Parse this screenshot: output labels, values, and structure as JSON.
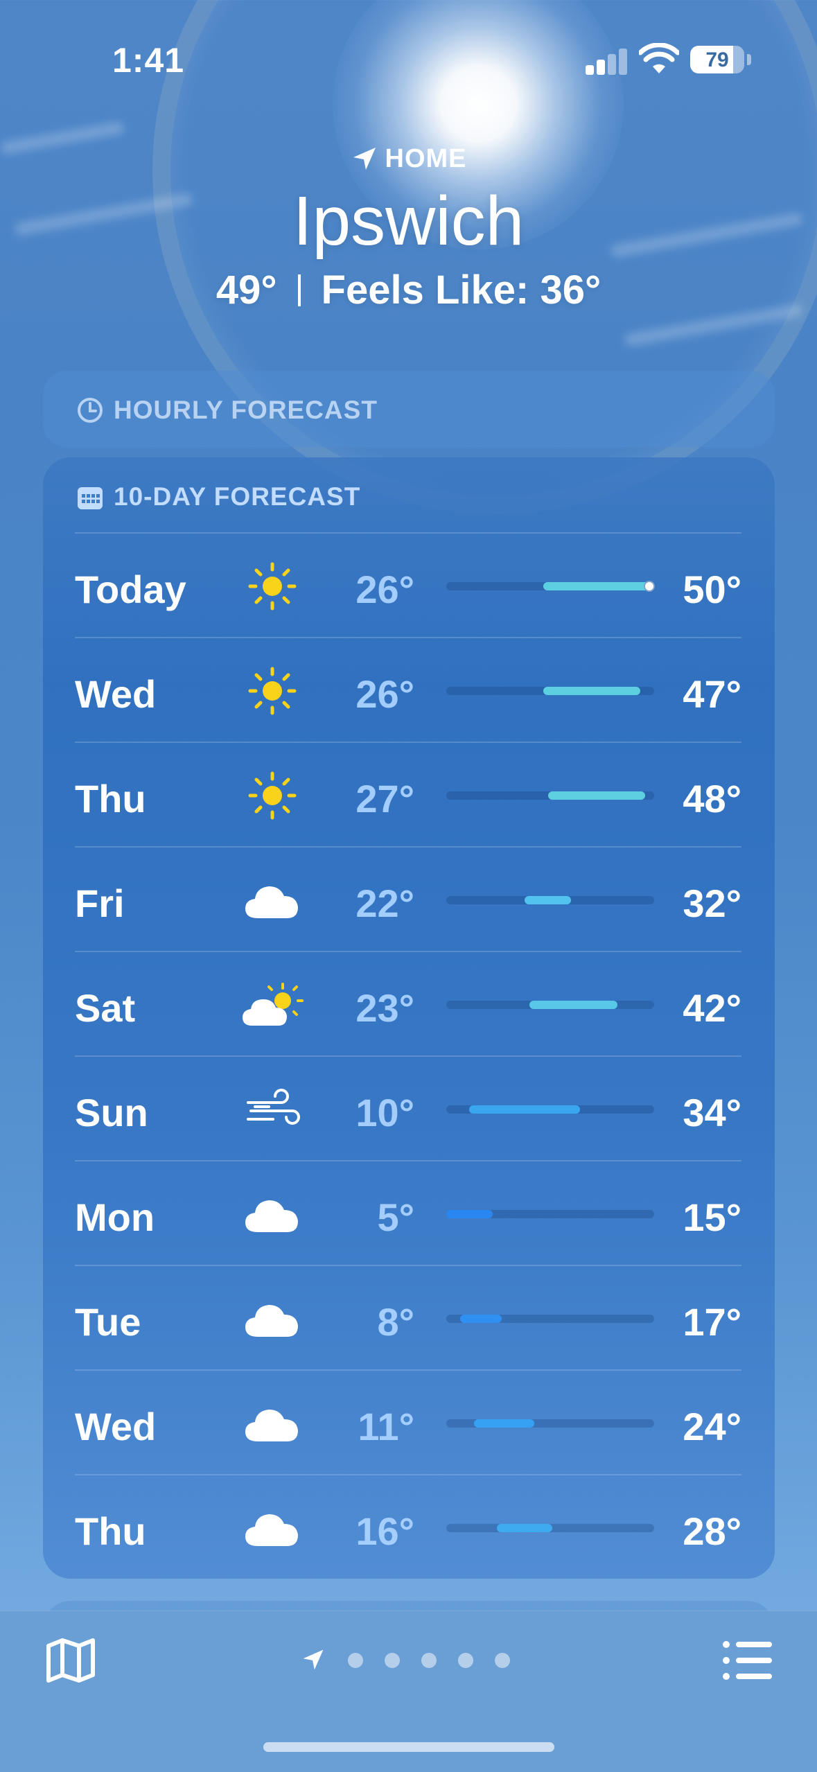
{
  "status_bar": {
    "time": "1:41",
    "battery": "79"
  },
  "location": {
    "label": "HOME",
    "city": "Ipswich",
    "temperature": "49°",
    "feels_like": "Feels Like: 36°"
  },
  "hourly": {
    "title": "HOURLY FORECAST"
  },
  "ten_day": {
    "title": "10-DAY FORECAST",
    "range_min": 5,
    "range_max": 50,
    "days": [
      {
        "day": "Today",
        "icon": "sun-icon",
        "low": "26°",
        "high": "50°",
        "low_val": 26,
        "high_val": 50,
        "current": 49,
        "color": "#5ccfe0"
      },
      {
        "day": "Wed",
        "icon": "sun-icon",
        "low": "26°",
        "high": "47°",
        "low_val": 26,
        "high_val": 47,
        "color": "#5ccfe0"
      },
      {
        "day": "Thu",
        "icon": "sun-icon",
        "low": "27°",
        "high": "48°",
        "low_val": 27,
        "high_val": 48,
        "color": "#5ccfe0"
      },
      {
        "day": "Fri",
        "icon": "cloud-icon",
        "low": "22°",
        "high": "32°",
        "low_val": 22,
        "high_val": 32,
        "color": "#52c2ee"
      },
      {
        "day": "Sat",
        "icon": "partly-cloudy-icon",
        "low": "23°",
        "high": "42°",
        "low_val": 23,
        "high_val": 42,
        "color": "#58c8e8"
      },
      {
        "day": "Sun",
        "icon": "wind-icon",
        "low": "10°",
        "high": "34°",
        "low_val": 10,
        "high_val": 34,
        "color": "#3aa6f0"
      },
      {
        "day": "Mon",
        "icon": "cloud-icon",
        "low": "5°",
        "high": "15°",
        "low_val": 5,
        "high_val": 15,
        "color": "#2a86f0"
      },
      {
        "day": "Tue",
        "icon": "cloud-icon",
        "low": "8°",
        "high": "17°",
        "low_val": 8,
        "high_val": 17,
        "color": "#2f90f2"
      },
      {
        "day": "Wed",
        "icon": "cloud-icon",
        "low": "11°",
        "high": "24°",
        "low_val": 11,
        "high_val": 24,
        "color": "#36a0f2"
      },
      {
        "day": "Thu",
        "icon": "cloud-icon",
        "low": "16°",
        "high": "28°",
        "low_val": 16,
        "high_val": 28,
        "color": "#3eaaf0"
      }
    ]
  },
  "toolbar": {
    "map_icon": "map-icon",
    "list_icon": "list-icon",
    "page_count": 6,
    "current_page": 0
  }
}
